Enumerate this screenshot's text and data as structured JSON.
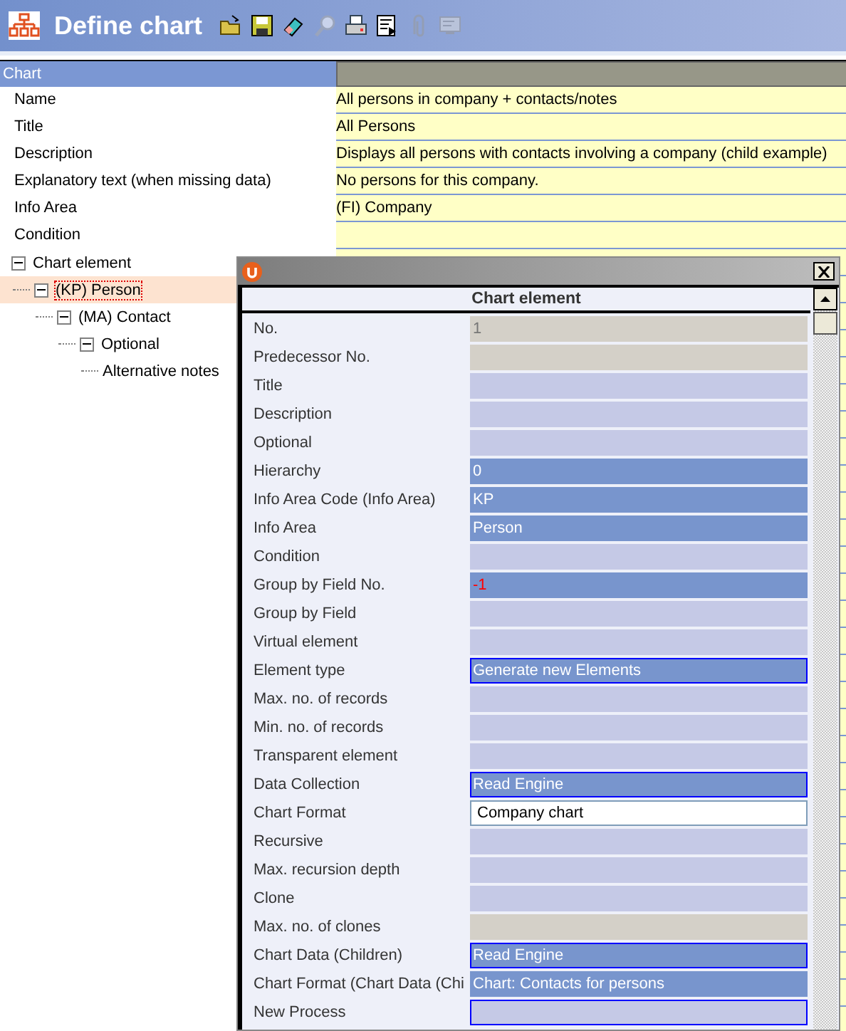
{
  "window": {
    "title": "Define chart"
  },
  "toolbar": [
    {
      "kind": "open",
      "disabled": false
    },
    {
      "kind": "save",
      "disabled": false
    },
    {
      "kind": "eraser",
      "disabled": false
    },
    {
      "kind": "magnifier",
      "disabled": true
    },
    {
      "kind": "print",
      "disabled": false
    },
    {
      "kind": "export",
      "disabled": false
    },
    {
      "kind": "attach",
      "disabled": true
    },
    {
      "kind": "screen",
      "disabled": true
    }
  ],
  "chart": {
    "heading": "Chart",
    "properties": [
      {
        "label": "Name",
        "value": "All persons in company + contacts/notes"
      },
      {
        "label": "Title",
        "value": "All Persons"
      },
      {
        "label": "Description",
        "value": "Displays all persons with contacts involving a company (child example)"
      },
      {
        "label": "Explanatory text (when missing data)",
        "value": "No persons for this company."
      },
      {
        "label": "Info Area",
        "value": "(FI) Company"
      },
      {
        "label": "Condition"
      }
    ]
  },
  "tree": [
    {
      "label": "Chart element",
      "expanded": true,
      "selected": false,
      "children": [
        {
          "label": "(KP) Person",
          "expanded": true,
          "selected": true,
          "children": [
            {
              "label": "(MA) Contact",
              "expanded": true,
              "selected": false,
              "children": [
                {
                  "label": "Optional",
                  "expanded": true,
                  "selected": false,
                  "children": [
                    {
                      "label": "Alternative notes",
                      "selected": false
                    }
                  ]
                }
              ]
            }
          ]
        }
      ]
    }
  ],
  "dialog": {
    "heading": "Chart element",
    "fields": [
      {
        "label": "No.",
        "kind": "readonly",
        "value": "1",
        "focused": false
      },
      {
        "label": "Predecessor No.",
        "kind": "readonly",
        "focused": false
      },
      {
        "label": "Title",
        "kind": "empty",
        "focused": false
      },
      {
        "label": "Description",
        "kind": "empty",
        "focused": false
      },
      {
        "label": "Optional",
        "kind": "empty",
        "focused": false
      },
      {
        "label": "Hierarchy",
        "kind": "set",
        "value": "0",
        "focused": false
      },
      {
        "label": "Info Area Code (Info Area)",
        "kind": "set",
        "value": "KP",
        "focused": false
      },
      {
        "label": "Info Area",
        "kind": "set",
        "value": "Person",
        "focused": false
      },
      {
        "label": "Condition",
        "kind": "empty",
        "focused": false
      },
      {
        "label": "Group by Field No.",
        "kind": "set",
        "value": "-1",
        "focused": false,
        "warning": true
      },
      {
        "label": "Group by Field",
        "kind": "empty",
        "focused": false
      },
      {
        "label": "Virtual element",
        "kind": "empty",
        "focused": false
      },
      {
        "label": "Element type",
        "kind": "set",
        "value": "Generate new Elements",
        "focused": true
      },
      {
        "label": "Max. no. of records",
        "kind": "empty",
        "focused": false
      },
      {
        "label": "Min. no. of records",
        "kind": "empty",
        "focused": false
      },
      {
        "label": "Transparent element",
        "kind": "empty",
        "focused": false
      },
      {
        "label": "Data Collection",
        "kind": "set",
        "value": "Read Engine",
        "focused": true
      },
      {
        "label": "Chart Format",
        "kind": "input",
        "value": "Company chart",
        "focused": false
      },
      {
        "label": "Recursive",
        "kind": "empty",
        "focused": false
      },
      {
        "label": "Max. recursion depth",
        "kind": "empty",
        "focused": false
      },
      {
        "label": "Clone",
        "kind": "empty",
        "focused": false
      },
      {
        "label": "Max. no. of clones",
        "kind": "readonly",
        "focused": false
      },
      {
        "label": "Chart Data (Children)",
        "kind": "set",
        "value": "Read Engine",
        "focused": true
      },
      {
        "label": "Chart Format (Chart Data (Chi",
        "kind": "set",
        "value": "Chart: Contacts for persons",
        "focused": false
      },
      {
        "label": "New Process",
        "kind": "empty",
        "focused": true
      }
    ]
  }
}
